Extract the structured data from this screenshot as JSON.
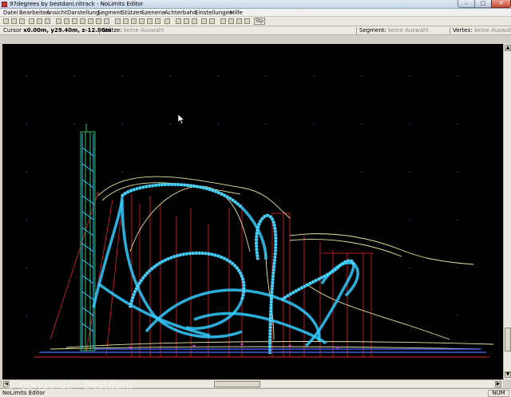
{
  "window": {
    "title": "97degrees by bestdani.nltrack - NoLimits Editor",
    "min_label": "–",
    "max_label": "□",
    "close_label": "✕"
  },
  "menu": [
    "Datei",
    "Bearbeiten",
    "Ansicht",
    "Darstellung",
    "Segment",
    "Stützen",
    "Szenerie",
    "Achterbahn",
    "Einstellungen",
    "Hilfe"
  ],
  "toolbar": {
    "step_label": "Stp"
  },
  "status_row": {
    "cursor_label": "Cursor",
    "cursor_value": "x0.00m, y29.40m, z-12.80m",
    "stutze_label": "Stütze:",
    "stutze_value": "keine Auswahl",
    "segment_label": "Segment:",
    "segment_value": "keine Auswahl",
    "vertex_label": "Vertex:",
    "vertex_value": "keine Auswahl"
  },
  "statusbar": {
    "text": "NoLimits Editor",
    "num": "NUM"
  },
  "watermark": "© opride.de - bestdani",
  "colors": {
    "viewport_bg": "#000000",
    "track_cyan": "#33ccff",
    "support_red": "#c0202a",
    "rail_yellow": "#e8e8a0",
    "tower_green": "#2fbf6f"
  }
}
